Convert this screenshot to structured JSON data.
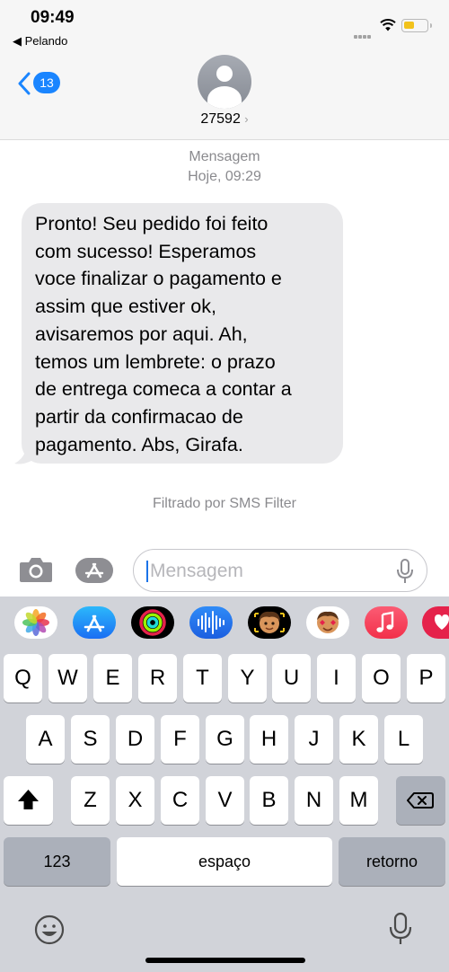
{
  "status_bar": {
    "time": "09:49",
    "back_app": "◀ Pelando"
  },
  "header": {
    "unread_count": "13",
    "contact_name": "27592",
    "contact_chevron": "›"
  },
  "thread": {
    "service_label": "Mensagem",
    "timestamp": "Hoje, 09:29",
    "message_lines": [
      "Pronto! Seu pedido foi feito",
      "com sucesso! Esperamos",
      "voce finalizar o pagamento e",
      "assim que estiver ok,",
      "avisaremos por aqui. Ah,",
      "temos um lembrete: o prazo",
      "de entrega comeca a contar a",
      "partir da confirmacao de",
      "pagamento. Abs, Girafa."
    ],
    "filter_note": "Filtrado por SMS Filter"
  },
  "composer": {
    "placeholder": "Mensagem"
  },
  "keyboard": {
    "apps": [
      "photos-app",
      "app-store-app",
      "fitness-app",
      "audio-message-app",
      "memoji-app",
      "memoji-stickers-app",
      "music-app",
      "digital-touch-app"
    ],
    "row1": [
      "Q",
      "W",
      "E",
      "R",
      "T",
      "Y",
      "U",
      "I",
      "O",
      "P"
    ],
    "row2": [
      "A",
      "S",
      "D",
      "F",
      "G",
      "H",
      "J",
      "K",
      "L"
    ],
    "row3": [
      "Z",
      "X",
      "C",
      "V",
      "B",
      "N",
      "M"
    ],
    "numbers_label": "123",
    "space_label": "espaço",
    "return_label": "retorno"
  },
  "colors": {
    "accent": "#1a85ff",
    "bubble": "#e9e9eb",
    "keyboard_bg": "#d1d3d9"
  }
}
